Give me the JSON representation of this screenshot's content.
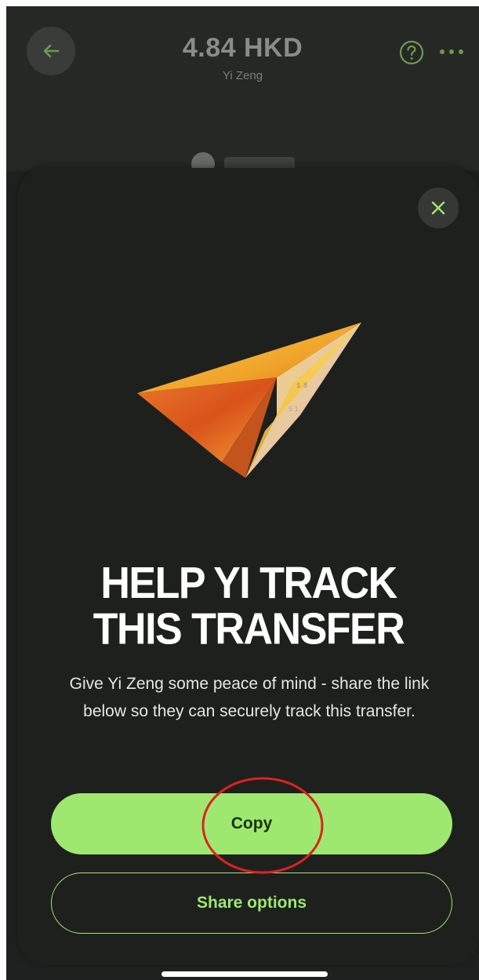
{
  "header": {
    "amount": "4.84 HKD",
    "recipient": "Yi Zeng",
    "back_icon": "arrow-left-icon",
    "help_icon": "question-circle-icon",
    "more_icon": "more-horizontal-icon"
  },
  "sheet": {
    "close_icon": "close-icon",
    "illustration": "paper-plane-illustration",
    "headline_line1": "HELP YI TRACK",
    "headline_line2": "THIS TRANSFER",
    "description": "Give Yi Zeng some peace of mind - share the link below so they can securely track this transfer.",
    "copy_label": "Copy",
    "share_label": "Share options"
  },
  "colors": {
    "accent": "#9fe870",
    "accent_text": "#163300",
    "background": "#1e201e",
    "annotation": "#e02020"
  }
}
